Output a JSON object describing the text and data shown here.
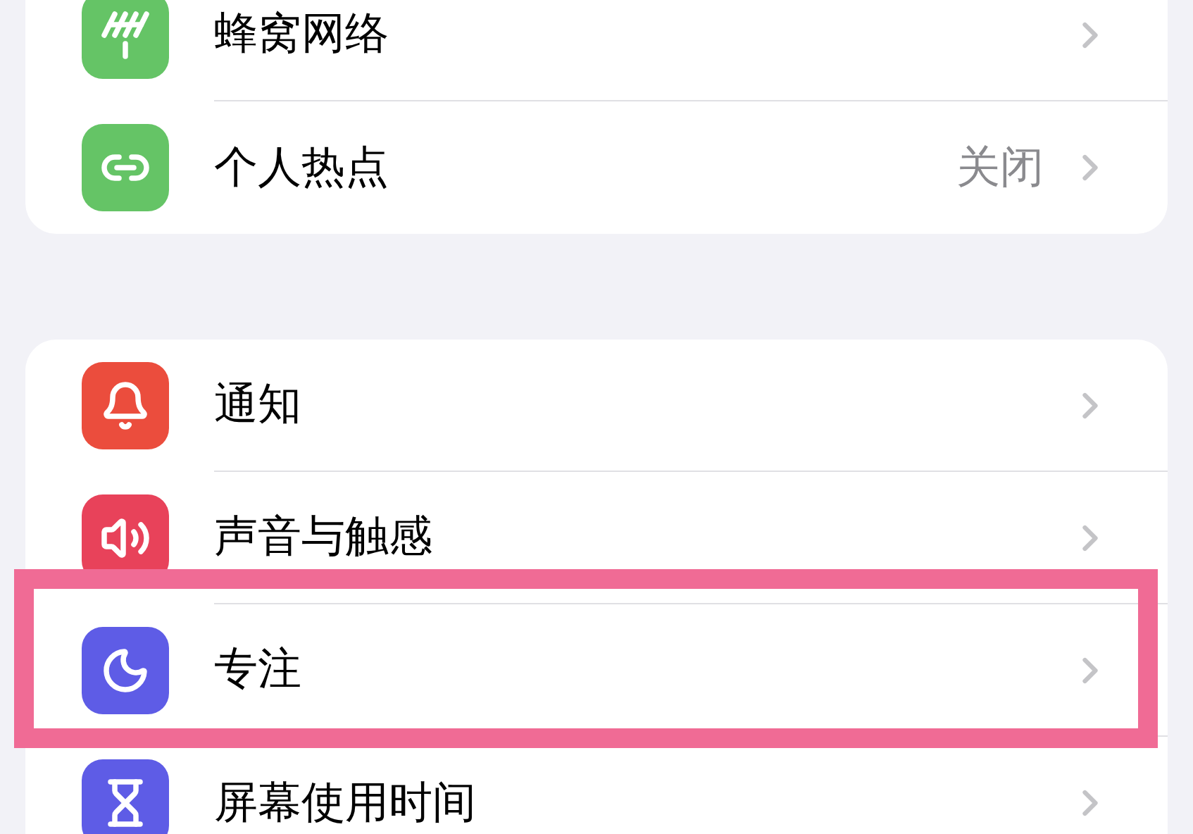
{
  "groups": [
    {
      "rows": [
        {
          "kind": "cellular",
          "color": "#65c466",
          "label": "蜂窝网络"
        },
        {
          "kind": "hotspot",
          "color": "#65c466",
          "label": "个人热点",
          "value": "关闭"
        }
      ]
    },
    {
      "rows": [
        {
          "kind": "notifications",
          "color": "#eb4d3d",
          "label": "通知"
        },
        {
          "kind": "sounds",
          "color": "#e8425a",
          "label": "声音与触感"
        },
        {
          "kind": "focus",
          "color": "#5e5ce6",
          "label": "专注",
          "highlighted": true
        },
        {
          "kind": "screentime",
          "color": "#5e5ce6",
          "label": "屏幕使用时间"
        }
      ]
    }
  ]
}
